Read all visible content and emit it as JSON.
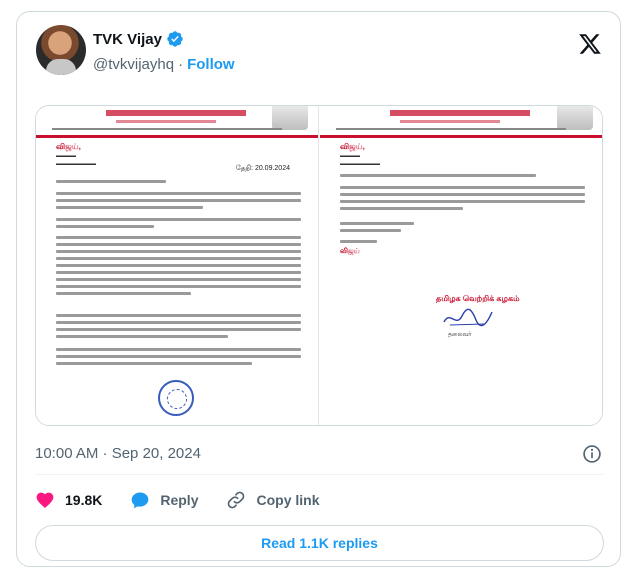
{
  "author": {
    "display_name": "TVK Vijay",
    "handle": "@tvkvijayhq",
    "follow_label": "Follow",
    "verified": true
  },
  "letter_left": {
    "sender": "விஜய்,",
    "date": "தேதி: 20.09.2024"
  },
  "letter_right": {
    "sender": "விஜய்,",
    "signature_name": "விஜய்",
    "party": "தமிழக வெற்றிக் கழகம்",
    "role": "தலைவர்"
  },
  "tweet": {
    "timestamp": "10:00 AM · Sep 20, 2024"
  },
  "actions": {
    "likes": "19.8K",
    "reply_label": "Reply",
    "copy_link_label": "Copy link"
  },
  "read_replies_label": "Read 1.1K replies",
  "colors": {
    "accent": "#1d9bf0",
    "like": "#f91880",
    "letterhead_red": "#c8102e"
  },
  "icons": {
    "verified": "verified-badge-icon",
    "x": "x-logo-icon",
    "info": "info-icon",
    "like": "heart-icon",
    "reply": "speech-bubble-icon",
    "copy_link": "link-icon"
  }
}
